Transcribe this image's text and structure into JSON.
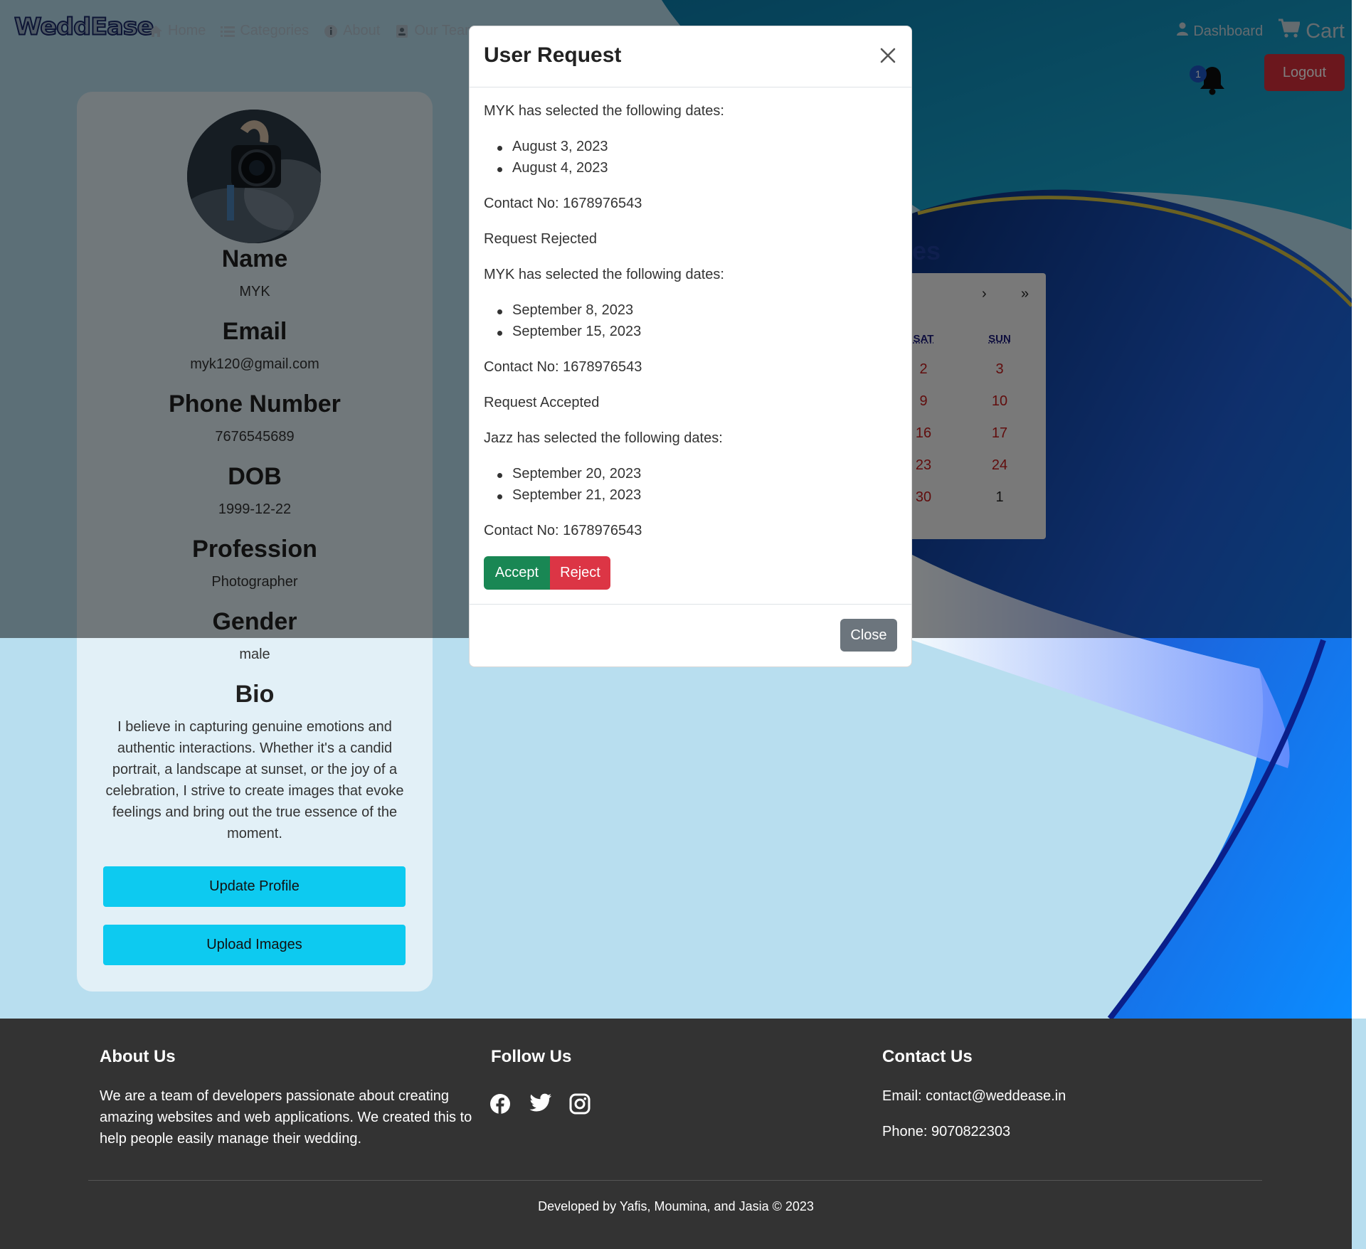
{
  "navbar": {
    "brand": "WeddEase",
    "links": [
      "Home",
      "Categories",
      "About",
      "Our Team"
    ],
    "dashboard": "Dashboard",
    "cart": "Cart",
    "notification_count": "1",
    "logout": "Logout"
  },
  "profile": {
    "name_label": "Name",
    "name": "MYK",
    "email_label": "Email",
    "email": "myk120@gmail.com",
    "phone_label": "Phone Number",
    "phone": "7676545689",
    "dob_label": "DOB",
    "dob": "1999-12-22",
    "profession_label": "Profession",
    "profession": "Photographer",
    "gender_label": "Gender",
    "gender": "male",
    "bio_label": "Bio",
    "bio": "I believe in capturing genuine emotions and authentic interactions. Whether it's a candid portrait, a landscape at sunset, or the joy of a celebration, I strive to create images that evoke feelings and bring out the true essence of the moment.",
    "update_button": "Update Profile",
    "upload_button": "Upload Images"
  },
  "calendar": {
    "title_fragment": "es",
    "nav_next": "›",
    "nav_last": "»",
    "headers": [
      "SAT",
      "SUN"
    ],
    "rows": [
      [
        "2",
        "3"
      ],
      [
        "9",
        "10"
      ],
      [
        "16",
        "17"
      ],
      [
        "23",
        "24"
      ],
      [
        "30",
        "1"
      ]
    ]
  },
  "modal": {
    "title": "User Request",
    "requests": [
      {
        "intro": "MYK has selected the following dates:",
        "dates": [
          "August 3, 2023",
          "August 4, 2023"
        ],
        "contact": "Contact No: 1678976543",
        "status": "Request Rejected"
      },
      {
        "intro": "MYK has selected the following dates:",
        "dates": [
          "September 8, 2023",
          "September 15, 2023"
        ],
        "contact": "Contact No: 1678976543",
        "status": "Request Accepted"
      },
      {
        "intro": "Jazz has selected the following dates:",
        "dates": [
          "September 20, 2023",
          "September 21, 2023"
        ],
        "contact": "Contact No: 1678976543"
      }
    ],
    "accept": "Accept",
    "reject": "Reject",
    "close": "Close"
  },
  "footer": {
    "about_title": "About Us",
    "about_text": "We are a team of developers passionate about creating amazing websites and web applications. We created this to help people easily manage their wedding.",
    "follow_title": "Follow Us",
    "social": [
      "facebook-icon",
      "twitter-icon",
      "instagram-icon"
    ],
    "contact_title": "Contact Us",
    "email": "Email: contact@weddease.in",
    "phone": "Phone: 9070822303",
    "copyright": "Developed by Yafis, Moumina, and Jasia © 2023"
  }
}
